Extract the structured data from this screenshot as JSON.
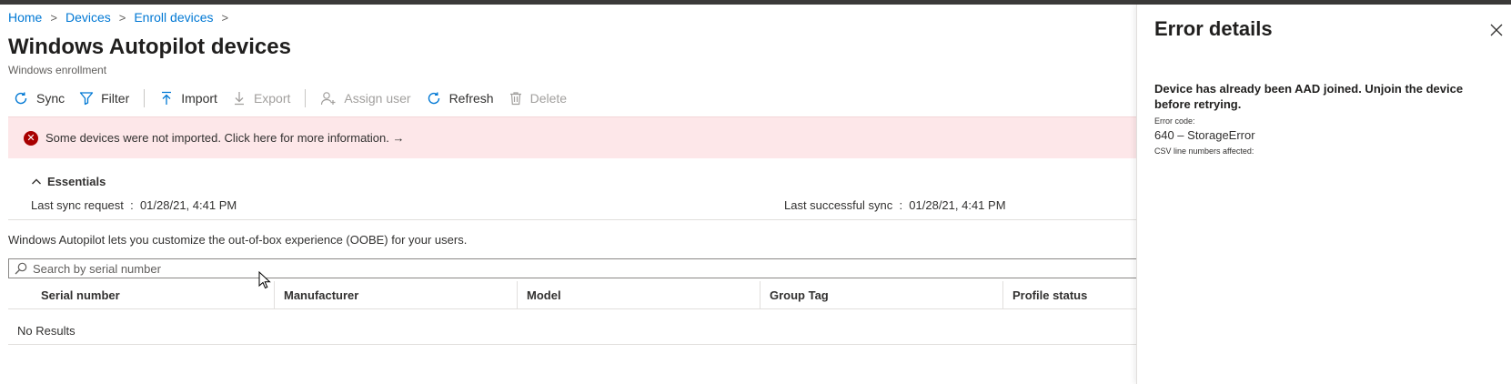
{
  "breadcrumb": [
    "Home",
    "Devices",
    "Enroll devices"
  ],
  "page": {
    "title": "Windows Autopilot devices",
    "subtitle": "Windows enrollment"
  },
  "toolbar": {
    "sync": "Sync",
    "filter": "Filter",
    "import": "Import",
    "export": "Export",
    "assign_user": "Assign user",
    "refresh": "Refresh",
    "delete": "Delete"
  },
  "banner": {
    "message": "Some devices were not imported. Click here for more information. →",
    "icon": "error-circle-icon"
  },
  "essentials": {
    "label": "Essentials",
    "last_sync_label": "Last sync request",
    "last_sync_value": "01/28/21, 4:41 PM",
    "last_success_label": "Last successful sync",
    "last_success_value": "01/28/21, 4:41 PM"
  },
  "description": "Windows Autopilot lets you customize the out-of-box experience (OOBE) for your users.",
  "search": {
    "placeholder": "Search by serial number"
  },
  "table": {
    "columns": [
      "Serial number",
      "Manufacturer",
      "Model",
      "Group Tag",
      "Profile status"
    ],
    "empty_text": "No Results"
  },
  "panel": {
    "title": "Error details",
    "message": "Device has already been AAD joined. Unjoin the device before retrying.",
    "error_code_label": "Error code:",
    "error_code_value": "640  –  StorageError",
    "csv_label": "CSV line numbers affected:"
  },
  "colors": {
    "accent": "#0078d4",
    "error": "#a80000",
    "banner_bg": "#fde7e9"
  }
}
